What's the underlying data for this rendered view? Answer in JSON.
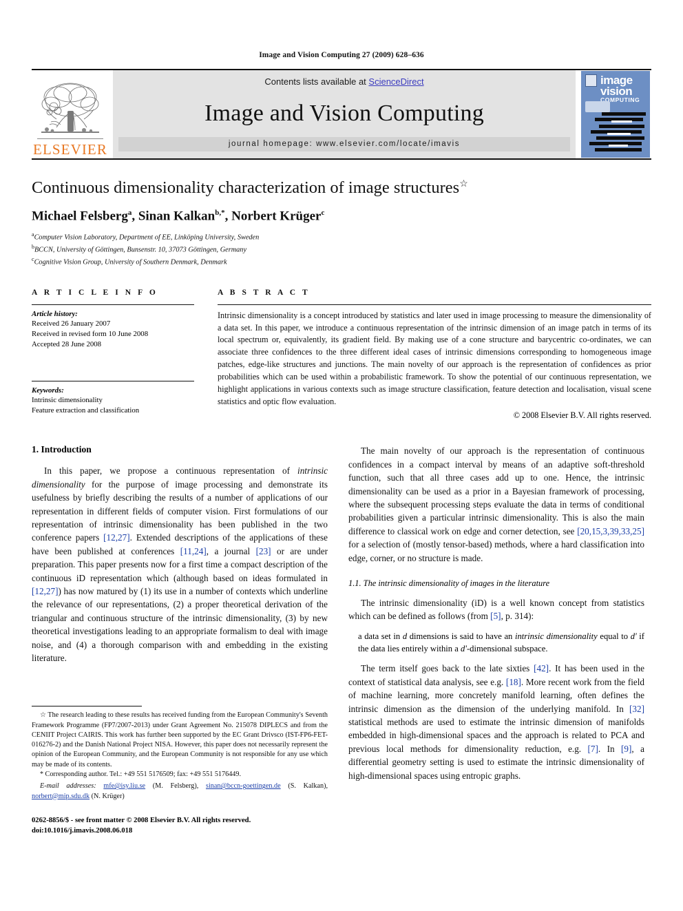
{
  "running_head": "Image and Vision Computing 27 (2009) 628–636",
  "masthead": {
    "publisher_name": "ELSEVIER",
    "contents_prefix": "Contents lists available at ",
    "contents_link": "ScienceDirect",
    "journal_name": "Image and Vision Computing",
    "homepage": "journal homepage: www.elsevier.com/locate/imavis",
    "cover": {
      "line1": "image",
      "line2": "vision",
      "line3": "COMPUTING"
    },
    "accent_color": "#E87722",
    "link_color": "#3b3bbf",
    "banner_bg": "#e3e3e3",
    "cover_bg": "#6d8fc4"
  },
  "article": {
    "title": "Continuous dimensionality characterization of image structures",
    "title_footnote_symbol": "☆",
    "authors_html": "Michael Felsberg<sup>a</sup>, Sinan Kalkan<sup>b,*</sup>, Norbert Krüger<sup>c</sup>",
    "affiliations": [
      {
        "marker": "a",
        "text": "Computer Vision Laboratory, Department of EE, Linköping University, Sweden"
      },
      {
        "marker": "b",
        "text": "BCCN, University of Göttingen, Bunsenstr. 10, 37073 Göttingen, Germany"
      },
      {
        "marker": "c",
        "text": "Cognitive Vision Group, University of Southern Denmark, Denmark"
      }
    ]
  },
  "article_info": {
    "label": "A R T I C L E   I N F O",
    "history_heading": "Article history:",
    "history": [
      "Received 26 January 2007",
      "Received in revised form 10 June 2008",
      "Accepted 28 June 2008"
    ],
    "keywords_heading": "Keywords:",
    "keywords": [
      "Intrinsic dimensionality",
      "Feature extraction and classification"
    ]
  },
  "abstract": {
    "label": "A B S T R A C T",
    "text": "Intrinsic dimensionality is a concept introduced by statistics and later used in image processing to measure the dimensionality of a data set. In this paper, we introduce a continuous representation of the intrinsic dimension of an image patch in terms of its local spectrum or, equivalently, its gradient field. By making use of a cone structure and barycentric co-ordinates, we can associate three confidences to the three different ideal cases of intrinsic dimensions corresponding to homogeneous image patches, edge-like structures and junctions. The main novelty of our approach is the representation of confidences as prior probabilities which can be used within a probabilistic framework. To show the potential of our continuous representation, we highlight applications in various contexts such as image structure classification, feature detection and localisation, visual scene statistics and optic flow evaluation.",
    "copyright": "© 2008 Elsevier B.V. All rights reserved."
  },
  "body": {
    "section1_heading": "1. Introduction",
    "left_p1_html": "In this paper, we propose a continuous representation of <em class=\"it\">intrinsic dimensionality</em> for the purpose of image processing and demonstrate its usefulness by briefly describing the results of a number of applications of our representation in different fields of computer vision. First formulations of our representation of intrinsic dimensionality has been published in the two conference papers <span class=\"cite\">[12,27]</span>. Extended descriptions of the applications of these have been published at conferences <span class=\"cite\">[11,24]</span>, a journal <span class=\"cite\">[23]</span> or are under preparation. This paper presents now for a first time a compact description of the continuous iD representation which (although based on ideas formulated in <span class=\"cite\">[12,27]</span>) has now matured by (1) its use in a number of contexts which underline the relevance of our representations, (2) a proper theoretical derivation of the triangular and continuous structure of the intrinsic dimensionality, (3) by new theoretical investigations leading to an appropriate formalism to deal with image noise, and (4) a thorough comparison with and embedding in the existing literature.",
    "right_p1_html": "The main novelty of our approach is the representation of continuous confidences in a compact interval by means of an adaptive soft-threshold function, such that all three cases add up to one. Hence, the intrinsic dimensionality can be used as a prior in a Bayesian framework of processing, where the subsequent processing steps evaluate the data in terms of conditional probabilities given a particular intrinsic dimensionality. This is also the main difference to classical work on edge and corner detection, see <span class=\"cite\">[20,15,3,39,33,25]</span> for a selection of (mostly tensor-based) methods, where a hard classification into edge, corner, or no structure is made.",
    "subsection11_heading": "1.1. The intrinsic dimensionality of images in the literature",
    "right_p2_html": "The intrinsic dimensionality (iD) is a well known concept from statistics which can be defined as follows (from <span class=\"cite\">[5]</span>, p. 314):",
    "right_quote_html": "a data set in <em class=\"it\">d</em> dimensions is said to have an <em class=\"it\">intrinsic dimensionality</em> equal to <em class=\"it\">d'</em> if the data lies entirely within a <em class=\"it\">d'</em>-dimensional subspace.",
    "right_p3_html": "The term itself goes back to the late sixties <span class=\"cite\">[42]</span>. It has been used in the context of statistical data analysis, see e.g. <span class=\"cite\">[18]</span>. More recent work from the field of machine learning, more concretely manifold learning, often defines the intrinsic dimension as the dimension of the underlying manifold. In <span class=\"cite\">[32]</span> statistical methods are used to estimate the intrinsic dimension of manifolds embedded in high-dimensional spaces and the approach is related to PCA and previous local methods for dimensionality reduction, e.g. <span class=\"cite\">[7]</span>. In <span class=\"cite\">[9]</span>, a differential geometry setting is used to estimate the intrinsic dimensionality of high-dimensional spaces using entropic graphs."
  },
  "footnotes": {
    "funding_symbol": "☆",
    "funding_html": "The research leading to these results has received funding from the European Community's Seventh Framework Programme (FP7/2007-2013) under Grant Agreement No. 215078 DIPLECS and from the CENIIT Project CAIRIS. This work has further been supported by the EC Grant Drivsco (IST-FP6-FET-016276-2) and the Danish National Project NISA. However, this paper does not necessarily represent the opinion of the European Community, and the European Community is not responsible for any use which may be made of its contents.",
    "corresponding_symbol": "*",
    "corresponding_html": "Corresponding author. Tel.: +49 551 5176509; fax: +49 551 5176449.",
    "email_label": "E-mail addresses:",
    "emails": [
      {
        "address": "mfe@isy.liu.se",
        "owner": "(M. Felsberg)"
      },
      {
        "address": "sinan@bccn-goettingen.de",
        "owner": "(S. Kalkan)"
      },
      {
        "address": "norbert@mip.sdu.dk",
        "owner": "(N. Krüger)"
      }
    ],
    "issn_line": "0262-8856/$ - see front matter © 2008 Elsevier B.V. All rights reserved.",
    "doi_line": "doi:10.1016/j.imavis.2008.06.018"
  }
}
